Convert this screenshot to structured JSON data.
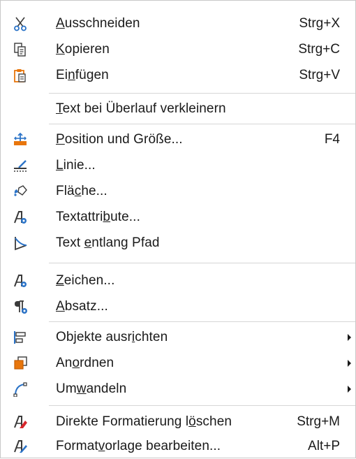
{
  "menu": {
    "items": [
      {
        "label": "Ausschneiden",
        "mnemonic_index": 0,
        "shortcut": "Strg+X",
        "icon": "scissors-icon"
      },
      {
        "label": "Kopieren",
        "mnemonic_index": 0,
        "shortcut": "Strg+C",
        "icon": "copy-icon"
      },
      {
        "label": "Einfügen",
        "mnemonic_index": 2,
        "shortcut": "Strg+V",
        "icon": "paste-icon"
      },
      {
        "label": "Text bei Überlauf verkleinern",
        "mnemonic_index": 0,
        "shortcut": ""
      },
      {
        "label": "Position und Größe...",
        "mnemonic_index": 0,
        "shortcut": "F4",
        "icon": "position-size-icon"
      },
      {
        "label": "Linie...",
        "mnemonic_index": 0,
        "shortcut": "",
        "icon": "line-icon"
      },
      {
        "label": "Fläche...",
        "mnemonic_index": 3,
        "shortcut": "",
        "icon": "area-fill-icon"
      },
      {
        "label": "Textattribute...",
        "mnemonic_index": 9,
        "shortcut": "",
        "icon": "text-attributes-icon"
      },
      {
        "label": "Text entlang Pfad",
        "mnemonic_index": 5,
        "shortcut": "",
        "icon": "text-on-path-icon"
      },
      {
        "label": "Zeichen...",
        "mnemonic_index": 0,
        "shortcut": "",
        "icon": "character-icon"
      },
      {
        "label": "Absatz...",
        "mnemonic_index": 0,
        "shortcut": "",
        "icon": "paragraph-icon"
      },
      {
        "label": "Objekte ausrichten",
        "mnemonic_index": 12,
        "shortcut": "",
        "icon": "align-objects-icon",
        "submenu": true
      },
      {
        "label": "Anordnen",
        "mnemonic_index": 2,
        "shortcut": "",
        "icon": "arrange-icon",
        "submenu": true
      },
      {
        "label": "Umwandeln",
        "mnemonic_index": 2,
        "shortcut": "",
        "icon": "convert-icon",
        "submenu": true
      },
      {
        "label": "Direkte Formatierung löschen",
        "mnemonic_index": 22,
        "shortcut": "Strg+M",
        "icon": "clear-formatting-icon"
      },
      {
        "label": "Formatvorlage bearbeiten...",
        "mnemonic_index": 6,
        "shortcut": "Alt+P",
        "icon": "edit-style-icon"
      }
    ]
  },
  "colors": {
    "accent_blue": "#2b73c7",
    "accent_orange": "#e8760c",
    "accent_red": "#d6262c",
    "text": "#1a1a1a",
    "separator": "#d6d6d6"
  }
}
